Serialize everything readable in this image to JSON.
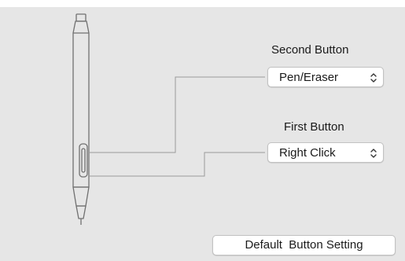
{
  "second_button": {
    "label": "Second Button",
    "selected": "Pen/Eraser"
  },
  "first_button": {
    "label": "First Button",
    "selected": "Right Click"
  },
  "default_button": {
    "label": "Default  Button Setting"
  },
  "icons": {
    "pen": "pen-icon",
    "select_chevron": "up-down-chevron-icon"
  },
  "colors": {
    "panel_background": "#e6e6e6",
    "control_background": "#ffffff",
    "connector_line": "#9a9a9a"
  }
}
